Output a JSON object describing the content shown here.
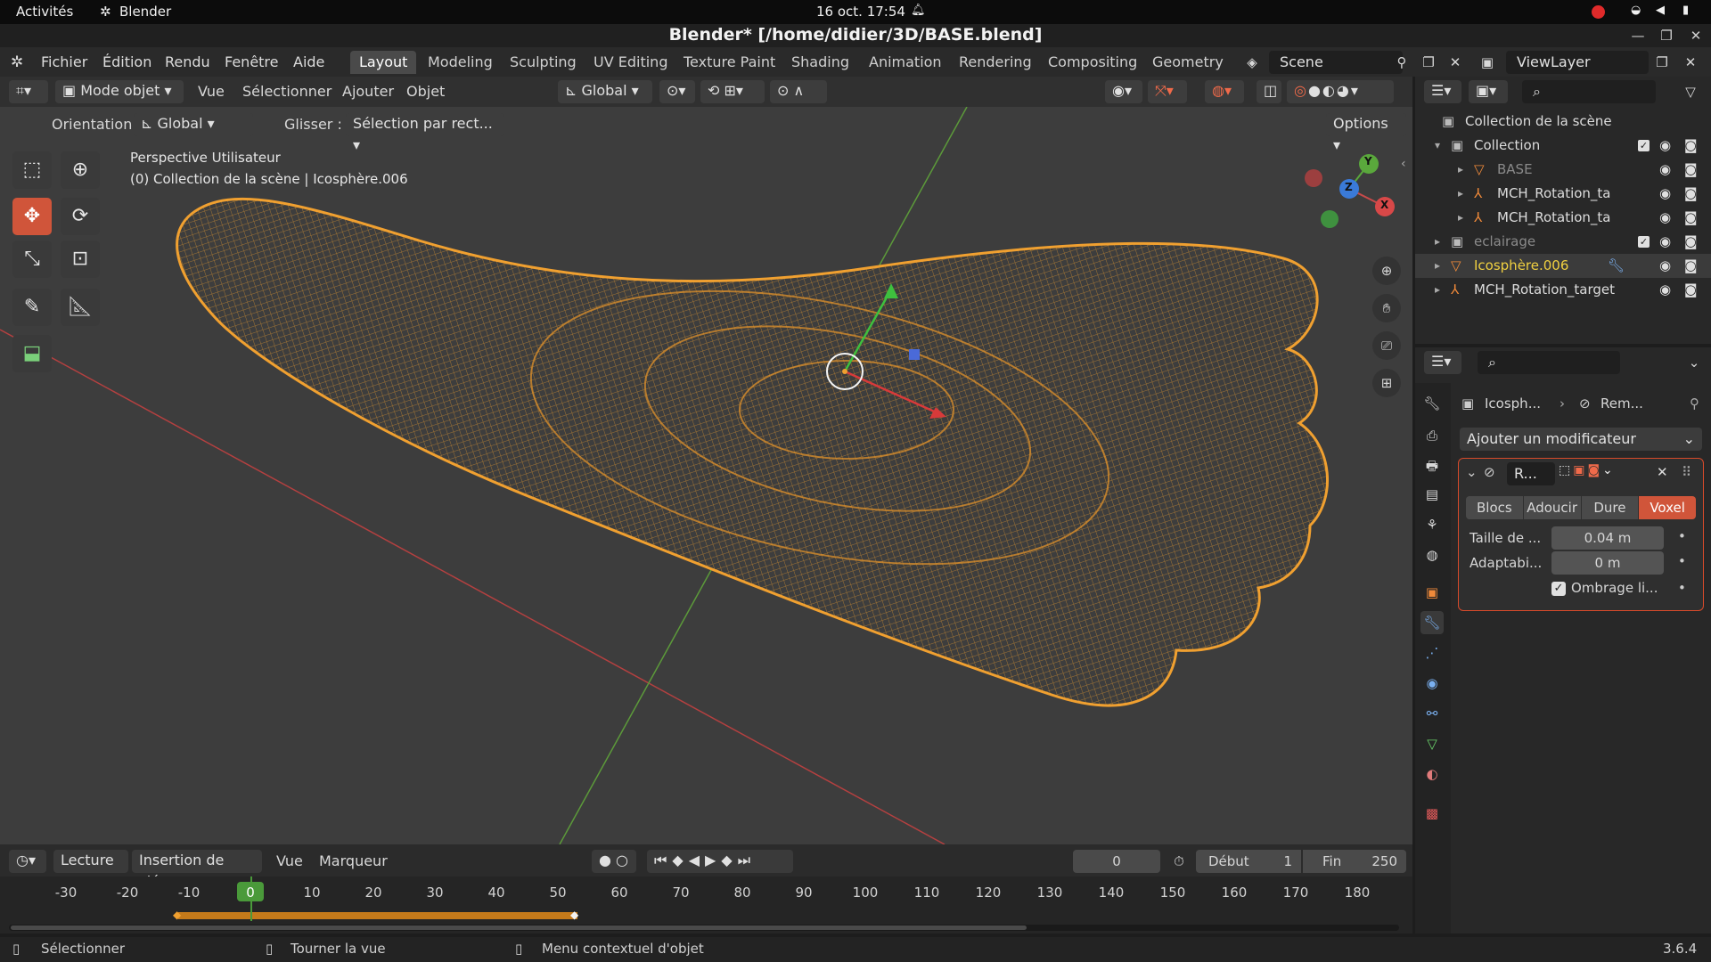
{
  "system_bar": {
    "activities": "Activités",
    "app": "Blender",
    "clock": "16 oct.  17:54"
  },
  "window": {
    "title": "Blender* [/home/didier/3D/BASE.blend]"
  },
  "menubar": {
    "items": [
      "Fichier",
      "Édition",
      "Rendu",
      "Fenêtre",
      "Aide"
    ],
    "workspaces": [
      "Layout",
      "Modeling",
      "Sculpting",
      "UV Editing",
      "Texture Paint",
      "Shading",
      "Animation",
      "Rendering",
      "Compositing",
      "Geometry N"
    ],
    "active_workspace": "Layout",
    "scene": "Scene",
    "view_layer": "ViewLayer"
  },
  "viewport_header": {
    "mode": "Mode objet",
    "menus": [
      "Vue",
      "Sélectionner",
      "Ajouter",
      "Objet"
    ],
    "transform": "Global",
    "orientation_label": "Orientation:",
    "orientation_value": "Global",
    "drag_label": "Glisser :",
    "drag_value": "Sélection par rect...",
    "options": "Options"
  },
  "viewport": {
    "view_name": "Perspective Utilisateur",
    "context": "(0) Collection de la scène | Icosphère.006",
    "gizmo": {
      "x": "X",
      "y": "Y",
      "z": "Z"
    },
    "wire_color": "#f0a030"
  },
  "outliner": {
    "root": "Collection de la scène",
    "rows": [
      {
        "label": "Collection",
        "indent": 1,
        "kind": "collection"
      },
      {
        "label": "BASE",
        "indent": 2,
        "kind": "mesh",
        "dim": true
      },
      {
        "label": "MCH_Rotation_ta",
        "indent": 2,
        "kind": "armature"
      },
      {
        "label": "MCH_Rotation_ta",
        "indent": 2,
        "kind": "armature"
      },
      {
        "label": "eclairage",
        "indent": 1,
        "kind": "collection",
        "dim": true
      },
      {
        "label": "Icosphère.006",
        "indent": 1,
        "kind": "mesh",
        "selected": true
      },
      {
        "label": "MCH_Rotation_target",
        "indent": 1,
        "kind": "armature"
      }
    ]
  },
  "properties": {
    "breadcrumb_object": "Icosph...",
    "breadcrumb_modifier": "Rem...",
    "add_modifier": "Ajouter un modificateur",
    "modifier_name": "R...",
    "modes": [
      "Blocs",
      "Adoucir",
      "Dure",
      "Voxel"
    ],
    "active_mode": "Voxel",
    "voxel_size_label": "Taille de ...",
    "voxel_size_value": "0.04 m",
    "adaptivity_label": "Adaptabi...",
    "adaptivity_value": "0 m",
    "smooth_label": "Ombrage li..."
  },
  "timeline": {
    "playback": "Lecture",
    "keying": "Insertion de clés",
    "view": "Vue",
    "marker": "Marqueur",
    "current_frame": "0",
    "start_label": "Début",
    "start_value": "1",
    "end_label": "Fin",
    "end_value": "250",
    "ruler": [
      "-30",
      "-20",
      "-10",
      "0",
      "10",
      "20",
      "30",
      "40",
      "50",
      "60",
      "70",
      "80",
      "90",
      "100",
      "110",
      "120",
      "130",
      "140",
      "150",
      "160",
      "170",
      "180"
    ]
  },
  "statusbar": {
    "select": "Sélectionner",
    "rotate": "Tourner la vue",
    "context_menu": "Menu contextuel d'objet",
    "version": "3.6.4"
  }
}
